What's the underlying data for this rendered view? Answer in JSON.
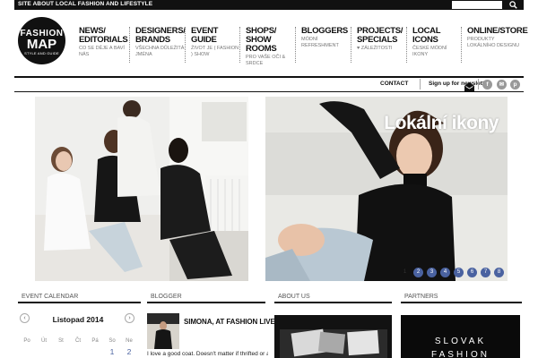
{
  "topbar": {
    "tagline": "SITE ABOUT LOCAL FASHION AND LIFESTYLE",
    "search_placeholder": "",
    "search_icon": "search-icon"
  },
  "logo": {
    "line1": "FASHION",
    "line2": "MAP",
    "line3": "STYLE AND GUIDE"
  },
  "nav": [
    {
      "title": "NEWS/\nEDITORIALS",
      "sub": "CO SE DĚJE A BAVÍ NÁS"
    },
    {
      "title": "DESIGNERS/\nBRANDS",
      "sub": "VŠECHNA DŮLEŽITÁ JMÉNA"
    },
    {
      "title": "EVENT GUIDE",
      "sub": "ŽIVOT JE ( FASHION ) SHOW"
    },
    {
      "title": "SHOPS/ SHOW\nROOMS",
      "sub": "PRO VAŠE OČI & SRDCE"
    },
    {
      "title": "BLOGGERS",
      "sub": "MÓDNÍ REFRESHMENT"
    },
    {
      "title": "PROJECTS/\nSPECIALS",
      "sub": "♥ ZÁLEŽITOSTI"
    },
    {
      "title": "LOCAL ICONS",
      "sub": "ČESKÉ MÓDNÍ IKONY"
    },
    {
      "title": "ONLINE/STORE",
      "sub": "PRODUKTY LOKÁLNÍHO DESIGNU"
    }
  ],
  "util": {
    "contact": "CONTACT",
    "newsletter": "Sign up for newsletter",
    "social_icons": [
      "facebook-icon",
      "email-icon",
      "pinterest-icon"
    ],
    "social_glyphs": [
      "f",
      "✉",
      "p"
    ]
  },
  "slider": {
    "title": "Lokální ikony",
    "dots": [
      "1",
      "2",
      "3",
      "4",
      "5",
      "6",
      "7",
      "8"
    ],
    "active": 1
  },
  "sections": {
    "calendar": "EVENT CALENDAR",
    "blogger": "BLOGGER",
    "about": "ABOUT US",
    "partners": "PARTNERS"
  },
  "calendar": {
    "month": "Listopad 2014",
    "prev": "‹",
    "next": "›",
    "days": [
      "Po",
      "Út",
      "St",
      "Čt",
      "Pá",
      "So",
      "Ne"
    ],
    "first_dates": [
      "1",
      "2"
    ]
  },
  "blog": {
    "title": "SIMONA, AT FASHION LIVE!",
    "excerpt": "I love a good coat. Doesn't matter if thrifted or a"
  },
  "partners": {
    "line1": "SLOVAK",
    "line2": "FASHION"
  },
  "colors": {
    "accent": "#4a62a0",
    "dark": "#111111"
  }
}
